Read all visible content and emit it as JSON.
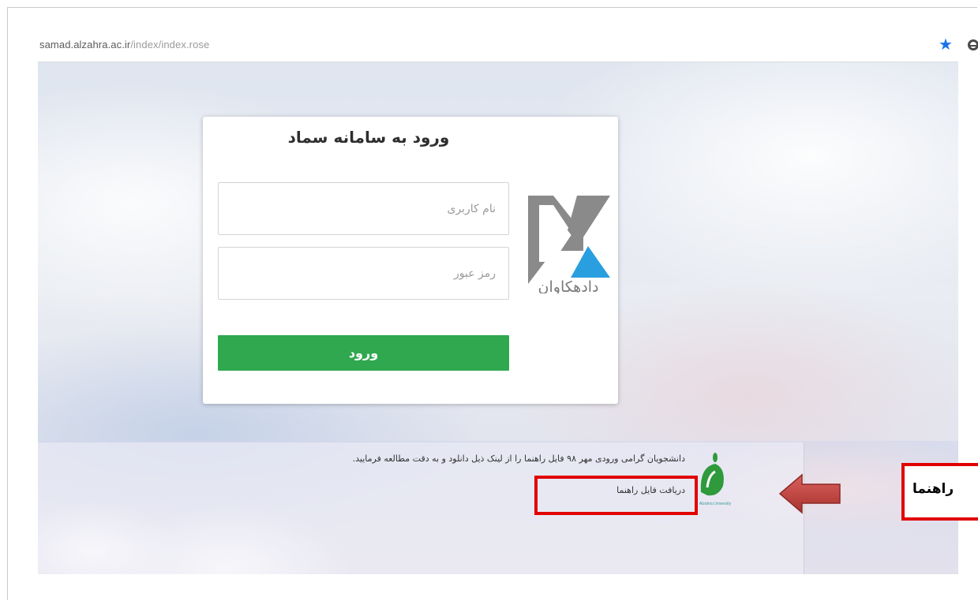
{
  "browser": {
    "url_host": "samad.alzahra.ac.ir",
    "url_path": "/index/index.rose"
  },
  "login": {
    "title": "ورود به سامانه سماد",
    "username_placeholder": "نام کاربری",
    "password_placeholder": "رمز عبور",
    "submit_label": "ورود",
    "button_color": "#2fa84f",
    "logo_text": "دادهکاوان"
  },
  "notice": {
    "message": "دانشجویان گرامی ورودی مهر ۹۸ فایل راهنما را از لینک ذیل دانلود و به دقت مطالعه فرمایید.",
    "link_label": "دریافت فایل راهنما",
    "university_logo_text": "Alzahra University"
  },
  "annotation": {
    "label": "راهنما",
    "box_color": "#e00000",
    "arrow_color": "#c0504d"
  }
}
